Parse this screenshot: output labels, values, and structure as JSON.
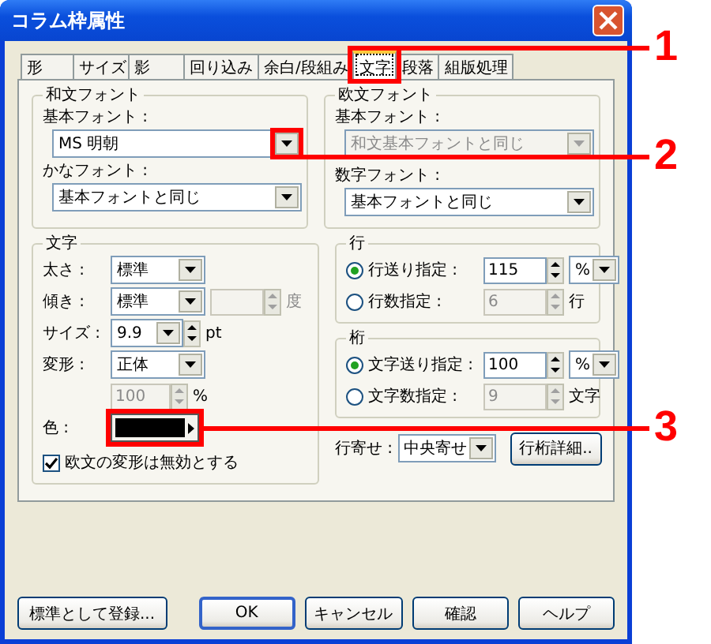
{
  "window": {
    "title": "コラム枠属性"
  },
  "tabs": [
    {
      "label": "形",
      "selected": false
    },
    {
      "label": "サイズ",
      "selected": false
    },
    {
      "label": "影",
      "selected": false
    },
    {
      "label": "回り込み",
      "selected": false
    },
    {
      "label": "余白/段組み",
      "selected": false
    },
    {
      "label": "文字",
      "selected": true
    },
    {
      "label": "段落",
      "selected": false
    },
    {
      "label": "組版処理",
      "selected": false
    }
  ],
  "japanese_font": {
    "title": "和文フォント",
    "base_font": {
      "label": "基本フォント :",
      "value": "MS 明朝"
    },
    "kana_font": {
      "label": "かなフォント :",
      "value": "基本フォントと同じ"
    }
  },
  "western_font": {
    "title": "欧文フォント",
    "base_font": {
      "label": "基本フォント :",
      "value": "和文基本フォントと同じ",
      "disabled": true
    },
    "numeral_font": {
      "label": "数字フォント :",
      "value": "基本フォントと同じ",
      "disabled": false
    }
  },
  "character": {
    "title": "文字",
    "weight": {
      "label": "太さ :",
      "value": "標準"
    },
    "slant": {
      "label": "傾き :",
      "value": "標準",
      "unit": "度"
    },
    "size": {
      "label": "サイズ :",
      "value": "9.9",
      "unit": "pt"
    },
    "transform": {
      "label": "変形 :",
      "value": "正体",
      "scale": "100",
      "unit": "%"
    },
    "color": {
      "label": "色 :",
      "color": "#000000"
    },
    "option": {
      "label": "欧文の変形は無効とする",
      "checked": true
    }
  },
  "line": {
    "title": "行",
    "options": [
      {
        "label": "行送り指定 :",
        "selected": true,
        "value": "115",
        "unit": "%"
      },
      {
        "label": "行数指定 :",
        "selected": false,
        "value": "6",
        "unit": "行"
      }
    ]
  },
  "column": {
    "title": "桁",
    "options": [
      {
        "label": "文字送り指定 :",
        "selected": true,
        "value": "100",
        "unit": "%"
      },
      {
        "label": "文字数指定 :",
        "selected": false,
        "value": "9",
        "unit": "文字"
      }
    ]
  },
  "alignment": {
    "label": "行寄せ :",
    "value": "中央寄せ"
  },
  "detail_button": "行桁詳細..",
  "buttons": [
    {
      "label": "標準として登録...",
      "kind": "normal"
    },
    {
      "label": "OK",
      "kind": "default"
    },
    {
      "label": "キャンセル",
      "kind": "normal"
    },
    {
      "label": "確認",
      "kind": "normal"
    },
    {
      "label": "ヘルプ",
      "kind": "normal"
    }
  ],
  "callouts": [
    {
      "label": "1"
    },
    {
      "label": "2"
    },
    {
      "label": "3"
    }
  ]
}
